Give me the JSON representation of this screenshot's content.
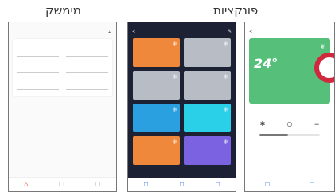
{
  "titles": {
    "left": "מימשק",
    "right": "פונקציות"
  },
  "phone1": {
    "status": {
      "left": "",
      "right": ""
    },
    "header": {
      "menu_label": "",
      "plus": "+"
    },
    "section": "",
    "rows": [
      [
        "",
        ""
      ],
      [
        "",
        ""
      ],
      [
        "",
        ""
      ]
    ],
    "extra": "",
    "tabs": [
      "⌂",
      "☐",
      "☐"
    ]
  },
  "phone2": {
    "status": {
      "left": "",
      "right": ""
    },
    "header": {
      "back": "<",
      "title": "",
      "edit": "✎"
    },
    "tiles": [
      {
        "color": "orange",
        "label": "",
        "value": ""
      },
      {
        "color": "gray",
        "label": "",
        "value": ""
      },
      {
        "color": "gray",
        "label": "",
        "value": ""
      },
      {
        "color": "gray",
        "label": "",
        "value": ""
      },
      {
        "color": "blue",
        "label": "",
        "value": ""
      },
      {
        "color": "cyan",
        "label": "",
        "value": ""
      },
      {
        "color": "orange",
        "label": "",
        "value": ""
      },
      {
        "color": "purple",
        "label": "",
        "value": ""
      }
    ],
    "tabs": [
      "☐",
      "☐",
      "☐"
    ]
  },
  "phone3": {
    "status": {
      "left": "",
      "right": ""
    },
    "header": {
      "back": "<",
      "title": "",
      "more": ""
    },
    "temp": "24°",
    "mode": "",
    "meta": "",
    "ctrls": [
      "✱",
      "○",
      "≈"
    ],
    "slider_level": 0.48,
    "tabs": [
      "☐",
      "☐"
    ]
  },
  "colors": {
    "accent": "#e8643c",
    "green": "#56c07a",
    "red": "#d0283c",
    "blue": "#3a78d8"
  }
}
